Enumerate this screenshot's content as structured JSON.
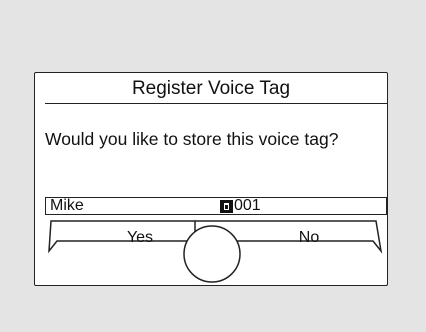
{
  "dialog": {
    "title": "Register Voice Tag",
    "message": "Would you like to store this voice tag?",
    "entry": {
      "name": "Mike",
      "slot": "001",
      "slot_icon": "phone-entry-icon"
    },
    "buttons": {
      "yes_label": "Yes",
      "no_label": "No"
    },
    "knob_icon": "selector-knob-icon"
  }
}
